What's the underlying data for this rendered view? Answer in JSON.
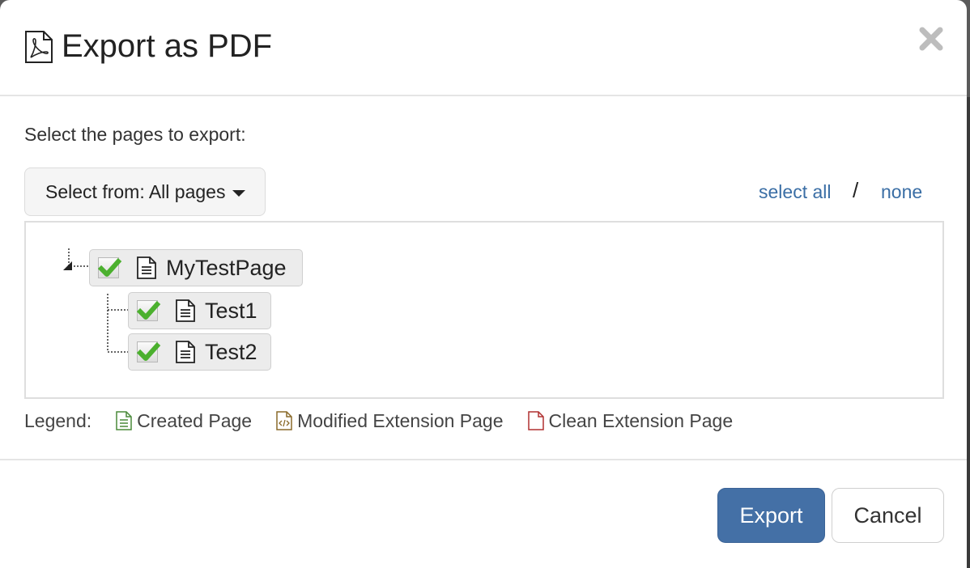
{
  "dialog": {
    "title": "Export as PDF",
    "title_icon": "pdf-file-icon",
    "close_icon": "close-icon"
  },
  "body": {
    "instructions": "Select the pages to export:",
    "select_from_label": "Select from: All pages",
    "select_all_label": "select all",
    "separator": "/",
    "none_label": "none"
  },
  "tree": {
    "root": {
      "label": "MyTestPage",
      "checked": true
    },
    "children": [
      {
        "label": "Test1",
        "checked": true
      },
      {
        "label": "Test2",
        "checked": true
      }
    ]
  },
  "legend": {
    "label": "Legend:",
    "items": [
      {
        "label": "Created Page",
        "icon": "created-page-icon",
        "color": "#4a8a3a"
      },
      {
        "label": "Modified Extension Page",
        "icon": "modified-extension-page-icon",
        "color": "#8a6a2a"
      },
      {
        "label": "Clean Extension Page",
        "icon": "clean-extension-page-icon",
        "color": "#b03030"
      }
    ]
  },
  "footer": {
    "export_label": "Export",
    "cancel_label": "Cancel"
  },
  "colors": {
    "primary": "#4470a6",
    "link": "#3a6ea5",
    "check": "#4bb02e"
  }
}
